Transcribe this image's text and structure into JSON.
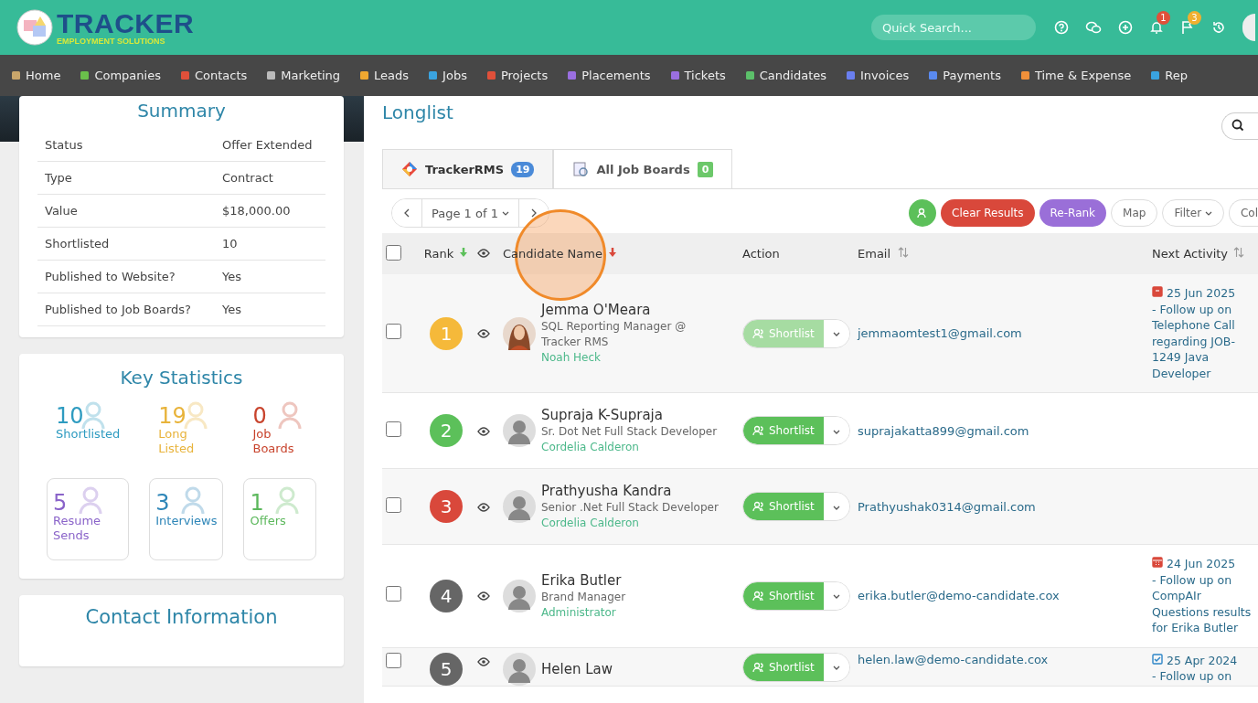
{
  "header": {
    "logo_title": "TRACKER",
    "logo_subtitle": "EMPLOYMENT SOLUTIONS",
    "search": {
      "placeholder": "Quick Search..."
    },
    "notifications": "1",
    "flags": "3"
  },
  "nav": [
    {
      "label": "Home",
      "color": "#c9a66b"
    },
    {
      "label": "Companies",
      "color": "#6abf4b"
    },
    {
      "label": "Contacts",
      "color": "#e0503a"
    },
    {
      "label": "Marketing",
      "color": "#bbbbbb"
    },
    {
      "label": "Leads",
      "color": "#f0a830"
    },
    {
      "label": "Jobs",
      "color": "#3aa3e0"
    },
    {
      "label": "Projects",
      "color": "#e0503a"
    },
    {
      "label": "Placements",
      "color": "#9a6fe0"
    },
    {
      "label": "Tickets",
      "color": "#9a6fe0"
    },
    {
      "label": "Candidates",
      "color": "#5cc06a"
    },
    {
      "label": "Invoices",
      "color": "#6a7ff0"
    },
    {
      "label": "Payments",
      "color": "#5a8af0"
    },
    {
      "label": "Time & Expense",
      "color": "#f0903a"
    },
    {
      "label": "Rep",
      "color": "#3aa3e0"
    }
  ],
  "summary": {
    "title": "Summary",
    "rows": [
      {
        "label": "Status",
        "value": "Offer Extended"
      },
      {
        "label": "Type",
        "value": "Contract"
      },
      {
        "label": "Value",
        "value": "$18,000.00"
      },
      {
        "label": "Shortlisted",
        "value": "10"
      },
      {
        "label": "Published to Website?",
        "value": "Yes"
      },
      {
        "label": "Published to Job Boards?",
        "value": "Yes"
      }
    ]
  },
  "key_statistics": {
    "title": "Key Statistics",
    "items": [
      {
        "kind": "plain",
        "count": "10",
        "label": "Shortlisted",
        "color": "#2e9bc0"
      },
      {
        "kind": "plain",
        "count": "19",
        "label": "Long Listed",
        "color": "#e8b33a"
      },
      {
        "kind": "plain",
        "count": "0",
        "label": "Job Boards",
        "color": "#c8432c"
      },
      {
        "kind": "boxed",
        "count": "5",
        "label": "Resume Sends",
        "color": "#8a63c9"
      },
      {
        "kind": "boxed",
        "count": "3",
        "label": "Interviews",
        "color": "#2e86b8"
      },
      {
        "kind": "boxed",
        "count": "1",
        "label": "Offers",
        "color": "#5cb85c"
      }
    ]
  },
  "contact_information": {
    "title": "Contact Information"
  },
  "longlist": {
    "title": "Longlist",
    "tabs": [
      {
        "label": "TrackerRMS",
        "count": "19",
        "selected": true
      },
      {
        "label": "All Job Boards",
        "count": "0",
        "selected": false
      }
    ],
    "pager": {
      "label": "Page 1 of 1"
    },
    "toolbar": {
      "clear": "Clear Results",
      "rerank": "Re-Rank",
      "map": "Map",
      "filter": "Filter",
      "columns": "Col"
    },
    "columns": [
      "Rank",
      "Candidate Name",
      "Action",
      "Email",
      "Next Activity"
    ],
    "select_all_checked": false,
    "rows": [
      {
        "rank": "1",
        "color": "#f5b93a",
        "name": "Jemma O'Meara",
        "title": "SQL Reporting Manager @ Tracker RMS",
        "owner": "Noah Heck",
        "photo": true,
        "checked": false,
        "action": "Shortlist",
        "disabled": true,
        "email": "jemmaomtest1@gmail.com",
        "activity": {
          "kind": "archive",
          "date": "25 Jun 2025",
          "text": "- Follow up on Telephone Call regarding JOB-1249 Java Developer"
        }
      },
      {
        "rank": "2",
        "color": "#5cc05a",
        "name": "Supraja K-Supraja",
        "title": "Sr. Dot Net Full Stack Developer",
        "owner": "Cordelia Calderon",
        "photo": false,
        "checked": false,
        "action": "Shortlist",
        "disabled": false,
        "email": "suprajakatta899@gmail.com"
      },
      {
        "rank": "3",
        "color": "#d9483b",
        "name": "Prathyusha Kandra",
        "title": "Senior .Net Full Stack Developer",
        "owner": "Cordelia Calderon",
        "photo": false,
        "checked": false,
        "action": "Shortlist",
        "disabled": false,
        "email": "Prathyushak0314@gmail.com"
      },
      {
        "rank": "4",
        "color": "#666666",
        "name": "Erika Butler",
        "title": "Brand Manager",
        "owner": "Administrator",
        "photo": false,
        "checked": false,
        "action": "Shortlist",
        "disabled": false,
        "email": "erika.butler@demo-candidate.cox",
        "activity": {
          "kind": "calendar",
          "date": "24 Jun 2025",
          "text": "- Follow up on CompAIr Questions results for Erika Butler"
        }
      },
      {
        "rank": "5",
        "color": "#666666",
        "name": "Helen Law",
        "photo": false,
        "checked": false,
        "action": "Shortlist",
        "disabled": false,
        "email": "helen.law@demo-candidate.cox",
        "activity": {
          "kind": "task",
          "date": "25 Apr 2024",
          "text": "- Follow up on"
        }
      }
    ]
  }
}
